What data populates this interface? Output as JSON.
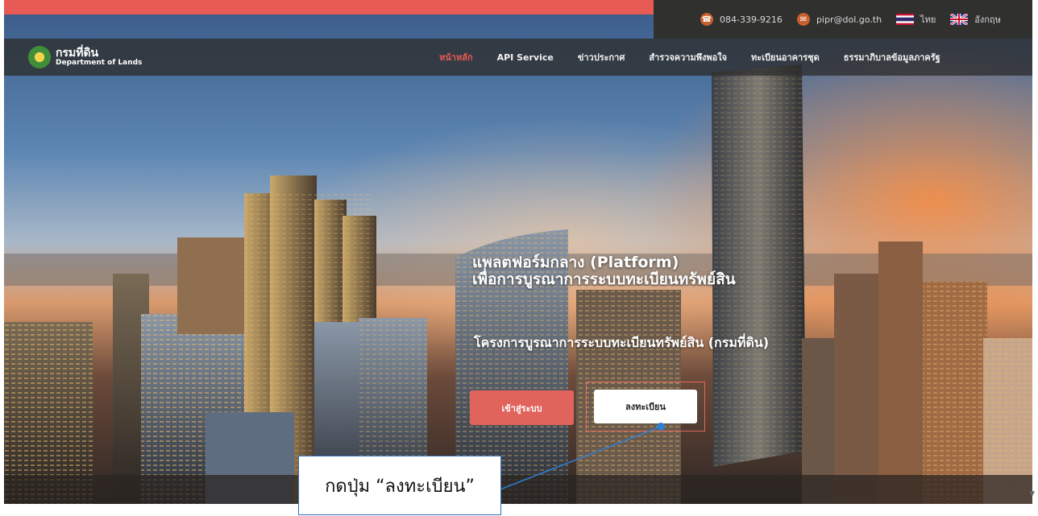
{
  "topbar": {
    "phone": "084-339-9216",
    "email": "pipr@dol.go.th",
    "lang_th": "ไทย",
    "lang_en": "อังกฤษ"
  },
  "logo": {
    "thai": "กรมที่ดิน",
    "english": "Department of Lands"
  },
  "nav": {
    "items": [
      {
        "label": "หน้าหลัก"
      },
      {
        "label": "API Service"
      },
      {
        "label": "ข่าวประกาศ"
      },
      {
        "label": "สำรวจความพึงพอใจ"
      },
      {
        "label": "ทะเบียนอาคารชุด"
      },
      {
        "label": "ธรรมาภิบาลข้อมูลภาครัฐ"
      }
    ],
    "active_index": 0
  },
  "hero": {
    "headline_line1": "แพลตฟอร์มกลาง (Platform)",
    "headline_line2": "เพื่อการบูรณาการระบบทะเบียนทรัพย์สิน",
    "subheadline": "โครงการบูรณาการระบบทะเบียนทรัพย์สิน (กรมที่ดิน)",
    "login_button": "เข้าสู่ระบบ",
    "register_button": "ลงทะเบียน"
  },
  "annotation": {
    "callout_text": "กดปุ่ม “ลงทะเบียน”"
  },
  "colors": {
    "accent": "#e85a54",
    "topbar_bg": "#30302f",
    "callout_border": "#2f6fb6",
    "pointer": "#2f7fd1"
  }
}
